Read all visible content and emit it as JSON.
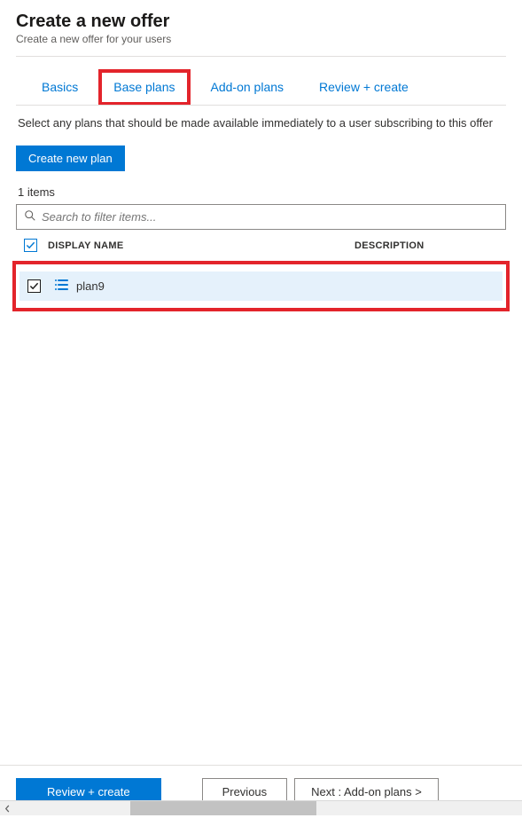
{
  "header": {
    "title": "Create a new offer",
    "subtitle": "Create a new offer for your users"
  },
  "tabs": {
    "items": [
      {
        "label": "Basics"
      },
      {
        "label": "Base plans"
      },
      {
        "label": "Add-on plans"
      },
      {
        "label": "Review + create"
      }
    ]
  },
  "instruction": "Select any plans that should be made available immediately to a user subscribing to this offer",
  "buttons": {
    "create_plan": "Create new plan",
    "review_create": "Review + create",
    "previous": "Previous",
    "next": "Next : Add-on plans >"
  },
  "list": {
    "count_label": "1 items",
    "search_placeholder": "Search to filter items...",
    "columns": {
      "display_name": "DISPLAY NAME",
      "description": "DESCRIPTION"
    },
    "rows": [
      {
        "name": "plan9",
        "description": ""
      }
    ]
  }
}
